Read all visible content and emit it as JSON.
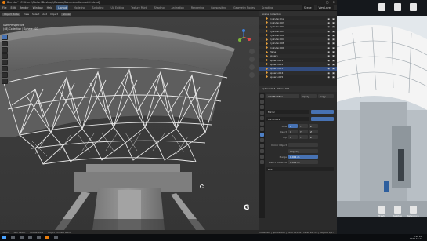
{
  "window": {
    "title": "Blender* [C:\\Users\\Stefan\\Desktop\\Course\\Scenes\\radio-model.blend]",
    "controls": [
      "—",
      "▢",
      "✕"
    ]
  },
  "menu": {
    "items": [
      "File",
      "Edit",
      "Render",
      "Window",
      "Help"
    ],
    "workspaces": [
      "Layout",
      "Modeling",
      "Sculpting",
      "UV Editing",
      "Texture Paint",
      "Shading",
      "Animation",
      "Rendering",
      "Compositing",
      "Geometry Nodes",
      "Scripting"
    ],
    "active_workspace": "Layout",
    "scene": "Scene",
    "view_layer": "ViewLayer"
  },
  "viewport": {
    "header": {
      "mode": "Object Mode",
      "menus": [
        "View",
        "Select",
        "Add",
        "Object"
      ],
      "orientation": "Global"
    },
    "info_line1": "User Perspective",
    "info_line2": "(48) Collection | Sphere.003",
    "symbol": "G"
  },
  "outliner": {
    "header_search": "Scene Collection",
    "rows": [
      {
        "label": "Cylinder.012",
        "selected": false
      },
      {
        "label": "Cylinder.003",
        "selected": false
      },
      {
        "label": "Cylinder.004",
        "selected": false
      },
      {
        "label": "Cylinder.005",
        "selected": false
      },
      {
        "label": "Cylinder.006",
        "selected": false
      },
      {
        "label": "Cylinder.007",
        "selected": false
      },
      {
        "label": "Cylinder.008",
        "selected": false
      },
      {
        "label": "Cylinder.009",
        "selected": false
      },
      {
        "label": "Plane",
        "selected": false
      },
      {
        "label": "Sphere",
        "selected": false
      },
      {
        "label": "Sphere.001",
        "selected": false
      },
      {
        "label": "Sphere.002",
        "selected": false
      },
      {
        "label": "Sphere.003",
        "selected": true
      },
      {
        "label": "Sphere.004",
        "selected": false
      },
      {
        "label": "Sphere.005",
        "selected": false
      }
    ]
  },
  "properties": {
    "object_name": "Sphere.003",
    "modifier_name": "Mirror.001",
    "add_modifier": "Add Modifier",
    "mod1": "Mirror",
    "mod2": "Mirror.001",
    "axis_label": "Axis",
    "bisect_label": "Bisect",
    "flip_label": "Flip",
    "axes": [
      "X",
      "Y",
      "Z"
    ],
    "mirror_object_label": "Mirror Object",
    "clipping_label": "Clipping",
    "merge_label": "Merge",
    "merge_value": "0.001 m",
    "bisect_distance_label": "Bisect Distance",
    "bisect_distance_value": "0.001 m",
    "data_label": "Data",
    "apply_label": "Apply",
    "copy_label": "Copy"
  },
  "statusbar": {
    "items": [
      "Select",
      "Box Select",
      "Rotate View",
      "Object Context Menu"
    ],
    "right": "Collection | Sphere.003 | Verts 31,284 | Faces 28,712 | Objects 1/17"
  },
  "desktop": {
    "icons": [
      "Trash",
      "Desktop",
      "Reference"
    ]
  },
  "taskbar": {
    "time": "5:16 PM",
    "date": "2022-10-14"
  }
}
